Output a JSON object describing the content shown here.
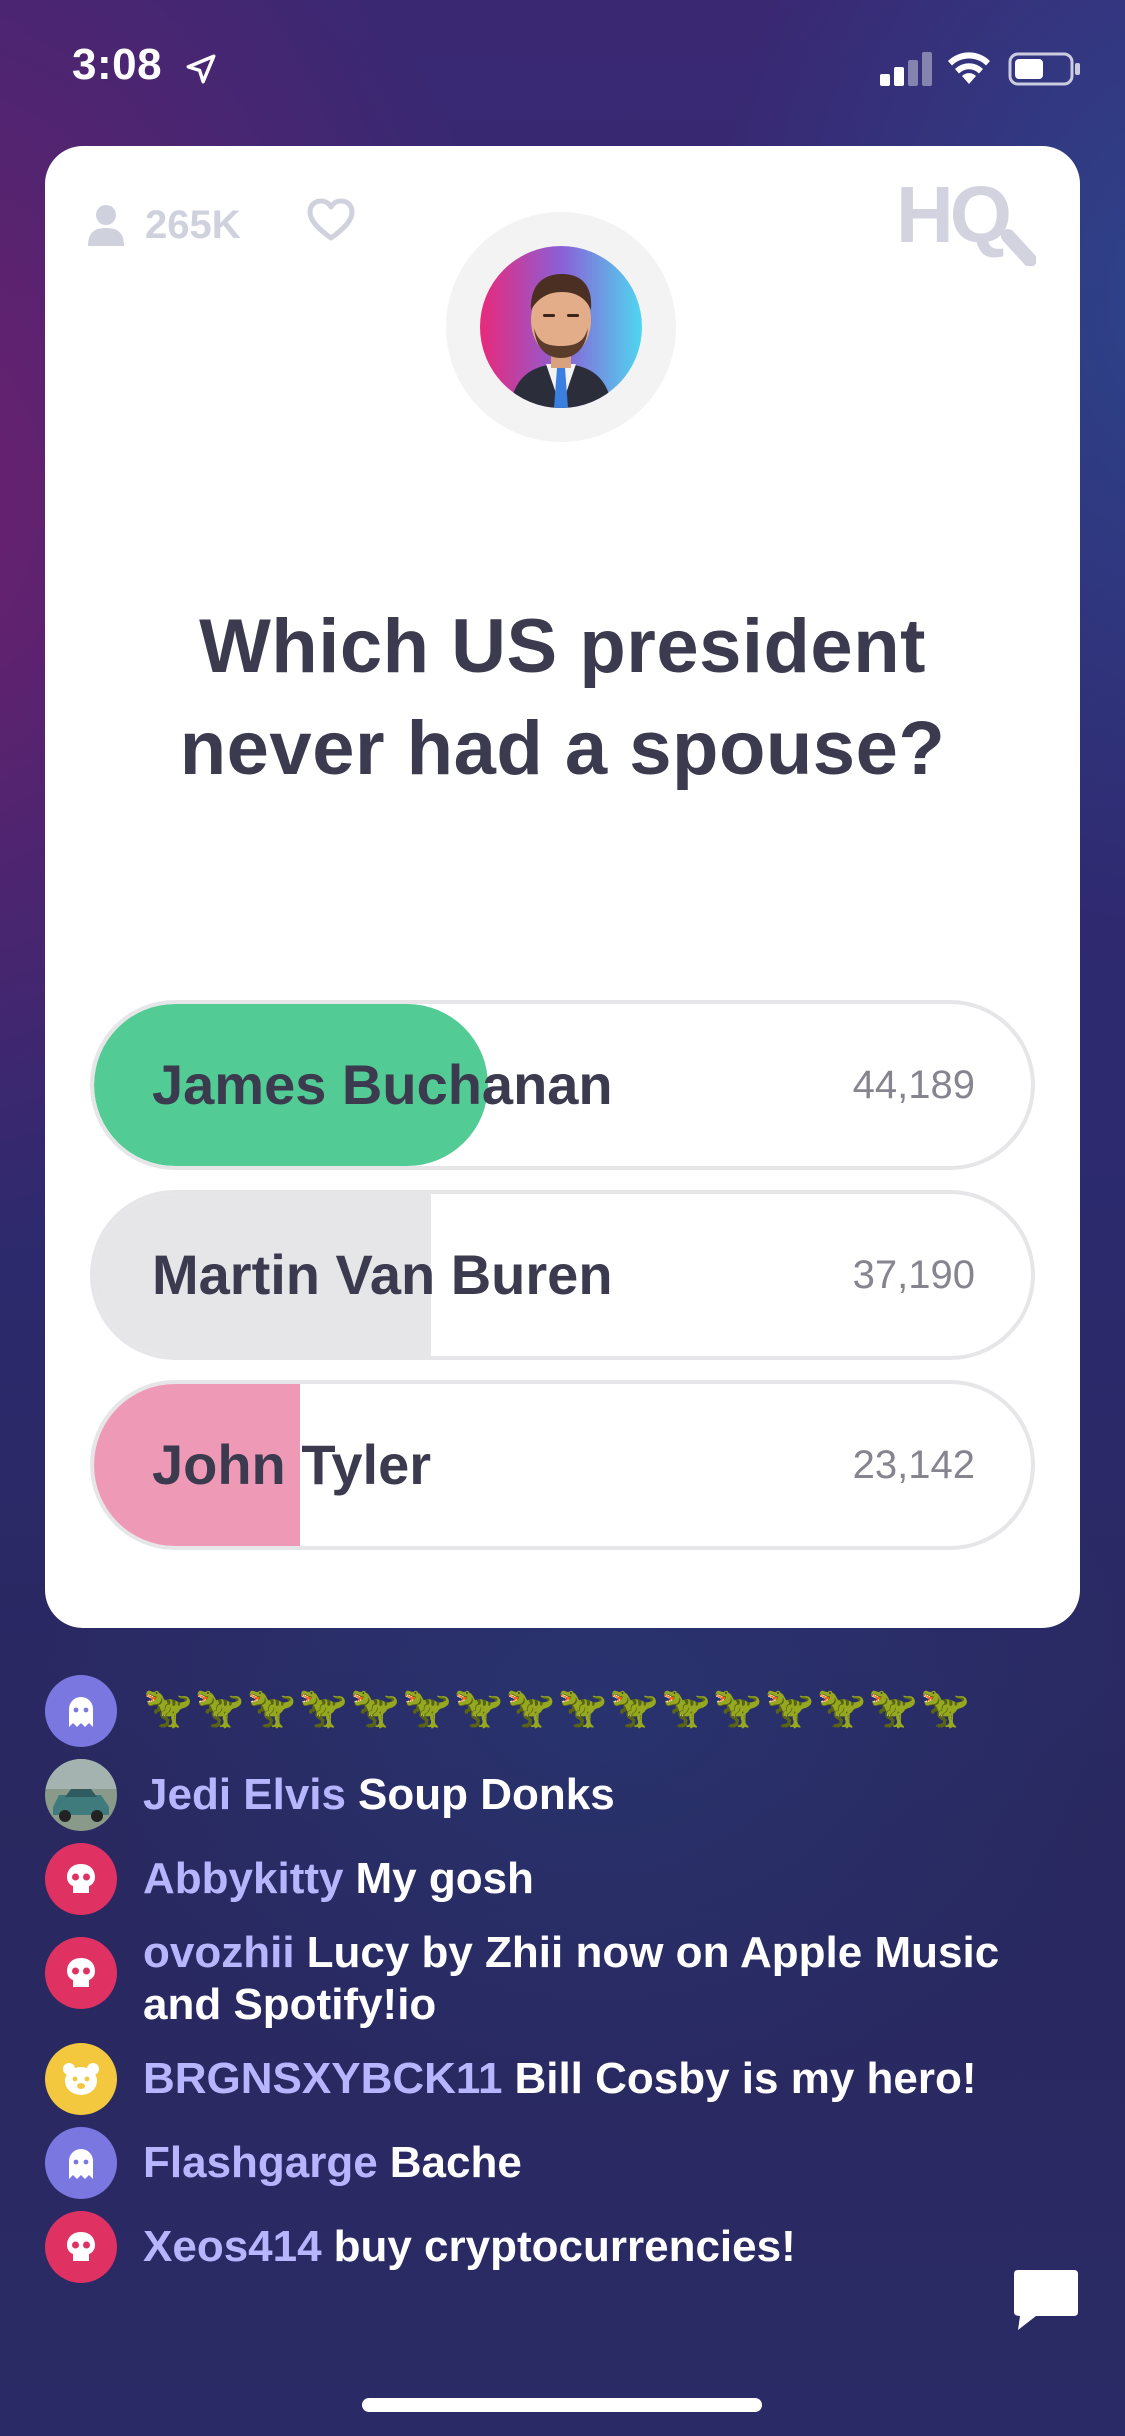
{
  "status_bar": {
    "time": "3:08"
  },
  "card": {
    "viewer_count": "265K",
    "logo_text": "HQ",
    "question": "Which US president never had a spouse?",
    "answers": [
      {
        "label": "James Buchanan",
        "votes": "44,189",
        "fill_fraction": 0.42,
        "fill_color": "#52cb94",
        "state": "correct"
      },
      {
        "label": "Martin Van Buren",
        "votes": "37,190",
        "fill_fraction": 0.36,
        "fill_color": "#e6e6e9",
        "state": "neutral"
      },
      {
        "label": "John Tyler",
        "votes": "23,142",
        "fill_fraction": 0.22,
        "fill_color": "#ee9ab6",
        "state": "wrong"
      }
    ]
  },
  "chat": {
    "messages": [
      {
        "user": "",
        "text": "🦖🦖🦖🦖🦖🦖🦖🦖🦖🦖🦖🦖🦖🦖🦖🦖",
        "avatar": "ghost-icon",
        "avatar_color": "#7a78e0"
      },
      {
        "user": "Jedi Elvis",
        "text": "Soup Donks",
        "avatar": "car-photo",
        "avatar_color": "#3f6b6e"
      },
      {
        "user": "Abbykitty",
        "text": "My gosh",
        "avatar": "skull-icon",
        "avatar_color": "#e03262"
      },
      {
        "user": "ovozhii",
        "text": "Lucy by Zhii now on Apple Music and Spotify!io",
        "avatar": "skull-icon",
        "avatar_color": "#e03262"
      },
      {
        "user": "BRGNSXYBCK11",
        "text": "Bill Cosby is my hero!",
        "avatar": "bear-icon",
        "avatar_color": "#f3c83f"
      },
      {
        "user": "Flashgarge",
        "text": "Bache",
        "avatar": "ghost-icon",
        "avatar_color": "#7a78e0"
      },
      {
        "user": "Xeos414",
        "text": "buy cryptocurrencies!",
        "avatar": "skull-icon",
        "avatar_color": "#e03262"
      }
    ]
  }
}
